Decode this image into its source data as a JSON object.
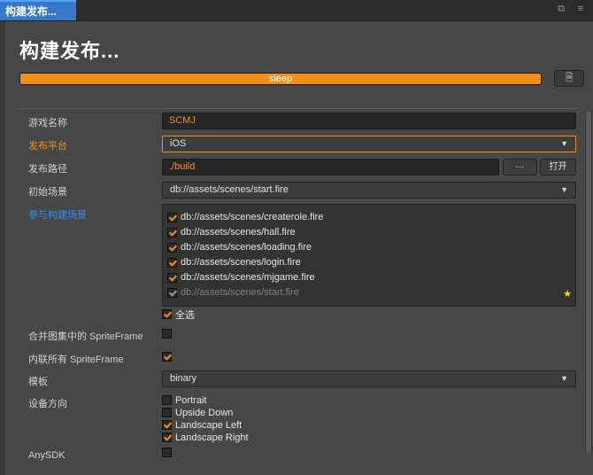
{
  "window": {
    "tab_label": "构建发布...",
    "title": "构建发布..."
  },
  "progress": {
    "label": "sleep",
    "fraction": 1.0,
    "color": "#f29018"
  },
  "form": {
    "game_name": {
      "label": "游戏名称",
      "value": "SCMJ"
    },
    "platform": {
      "label": "发布平台",
      "value": "iOS"
    },
    "path": {
      "label": "发布路径",
      "value": "./build",
      "browse_label": "···",
      "open_label": "打开"
    },
    "start_scene": {
      "label": "初始场景",
      "value": "db://assets/scenes/start.fire"
    },
    "scenes": {
      "label": "参与构建场景",
      "items": [
        {
          "path": "db://assets/scenes/createrole.fire",
          "checked": true,
          "disabled": false
        },
        {
          "path": "db://assets/scenes/hall.fire",
          "checked": true,
          "disabled": false
        },
        {
          "path": "db://assets/scenes/loading.fire",
          "checked": true,
          "disabled": false
        },
        {
          "path": "db://assets/scenes/login.fire",
          "checked": true,
          "disabled": false
        },
        {
          "path": "db://assets/scenes/mjgame.fire",
          "checked": true,
          "disabled": false
        },
        {
          "path": "db://assets/scenes/start.fire",
          "checked": true,
          "disabled": true
        }
      ],
      "select_all_label": "全选"
    },
    "merge_sprite": {
      "label": "合并图集中的 SpriteFrame",
      "checked": false
    },
    "inline_sprite": {
      "label": "内联所有 SpriteFrame",
      "checked": true
    },
    "template": {
      "label": "模板",
      "value": "binary"
    },
    "orientation": {
      "label": "设备方向",
      "options": [
        {
          "label": "Portrait",
          "checked": false
        },
        {
          "label": "Upside Down",
          "checked": false
        },
        {
          "label": "Landscape Left",
          "checked": true
        },
        {
          "label": "Landscape Right",
          "checked": true
        }
      ]
    },
    "anysdk": {
      "label": "AnySDK",
      "checked": false
    }
  },
  "colors": {
    "accent": "#f29018",
    "link": "#2d8fff",
    "tab": "#3778c7",
    "background": "#474747"
  }
}
